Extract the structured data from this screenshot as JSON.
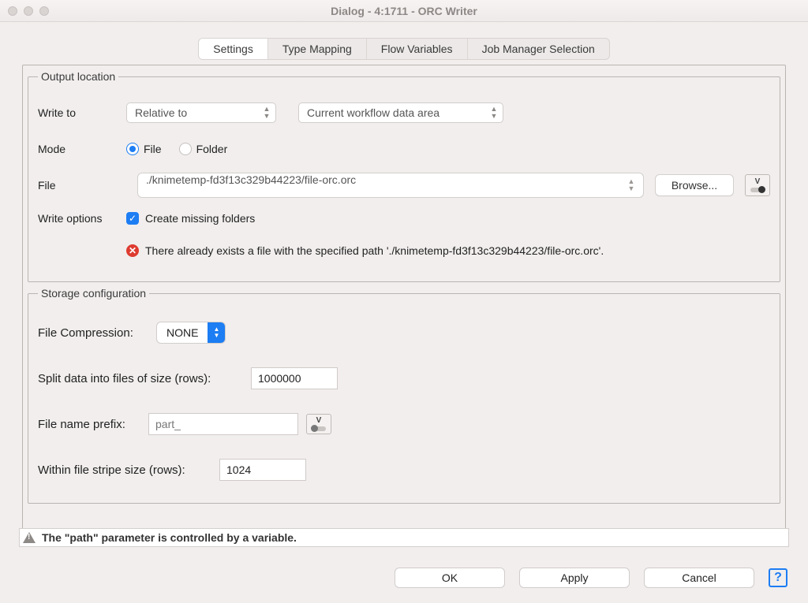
{
  "window": {
    "title": "Dialog - 4:1711 - ORC Writer"
  },
  "tabs": {
    "settings": "Settings",
    "type_mapping": "Type Mapping",
    "flow_variables": "Flow Variables",
    "job_manager": "Job Manager Selection"
  },
  "output_location": {
    "legend": "Output location",
    "write_to_label": "Write to",
    "write_to_select1": "Relative to",
    "write_to_select2": "Current workflow data area",
    "mode_label": "Mode",
    "mode_file": "File",
    "mode_folder": "Folder",
    "file_label": "File",
    "file_path": "./knimetemp-fd3f13c329b44223/file-orc.orc",
    "browse": "Browse...",
    "write_options_label": "Write options",
    "create_missing": "Create missing folders",
    "error_message": "There already exists a file with the specified path './knimetemp-fd3f13c329b44223/file-orc.orc'."
  },
  "storage": {
    "legend": "Storage configuration",
    "compression_label": "File Compression:",
    "compression_value": "NONE",
    "split_label": "Split data into files of size (rows):",
    "split_value": "1000000",
    "prefix_label": "File name prefix:",
    "prefix_value": "part_",
    "stripe_label": "Within file stripe size (rows):",
    "stripe_value": "1024"
  },
  "footer": {
    "message": "The \"path\" parameter is controlled by a variable."
  },
  "buttons": {
    "ok": "OK",
    "apply": "Apply",
    "cancel": "Cancel"
  }
}
